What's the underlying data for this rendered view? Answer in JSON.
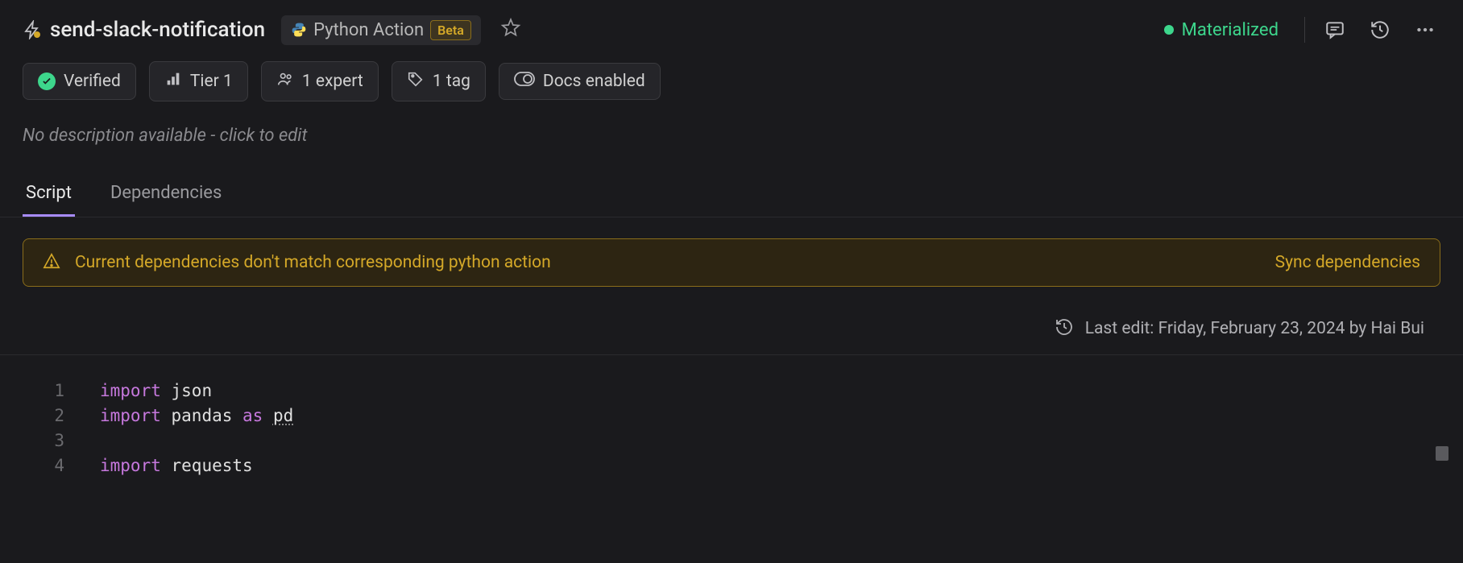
{
  "header": {
    "title": "send-slack-notification",
    "action_type": "Python Action",
    "beta_label": "Beta"
  },
  "status": {
    "label": "Materialized"
  },
  "chips": {
    "verified": "Verified",
    "tier": "Tier 1",
    "experts": "1 expert",
    "tags": "1 tag",
    "docs": "Docs enabled"
  },
  "description": "No description available - click to edit",
  "tabs": {
    "script": "Script",
    "dependencies": "Dependencies"
  },
  "warning": {
    "message": "Current dependencies don't match corresponding python action",
    "action": "Sync dependencies"
  },
  "last_edit": "Last edit: Friday, February 23, 2024 by Hai Bui",
  "code": {
    "lines": [
      {
        "num": "1",
        "tokens": [
          {
            "t": "import ",
            "c": "kw"
          },
          {
            "t": "json",
            "c": "id"
          }
        ]
      },
      {
        "num": "2",
        "tokens": [
          {
            "t": "import ",
            "c": "kw"
          },
          {
            "t": "pandas ",
            "c": "id"
          },
          {
            "t": "as ",
            "c": "op"
          },
          {
            "t": "pd",
            "c": "id",
            "u": true
          }
        ]
      },
      {
        "num": "3",
        "tokens": []
      },
      {
        "num": "4",
        "tokens": [
          {
            "t": "import ",
            "c": "kw"
          },
          {
            "t": "requests",
            "c": "id"
          }
        ]
      }
    ]
  }
}
